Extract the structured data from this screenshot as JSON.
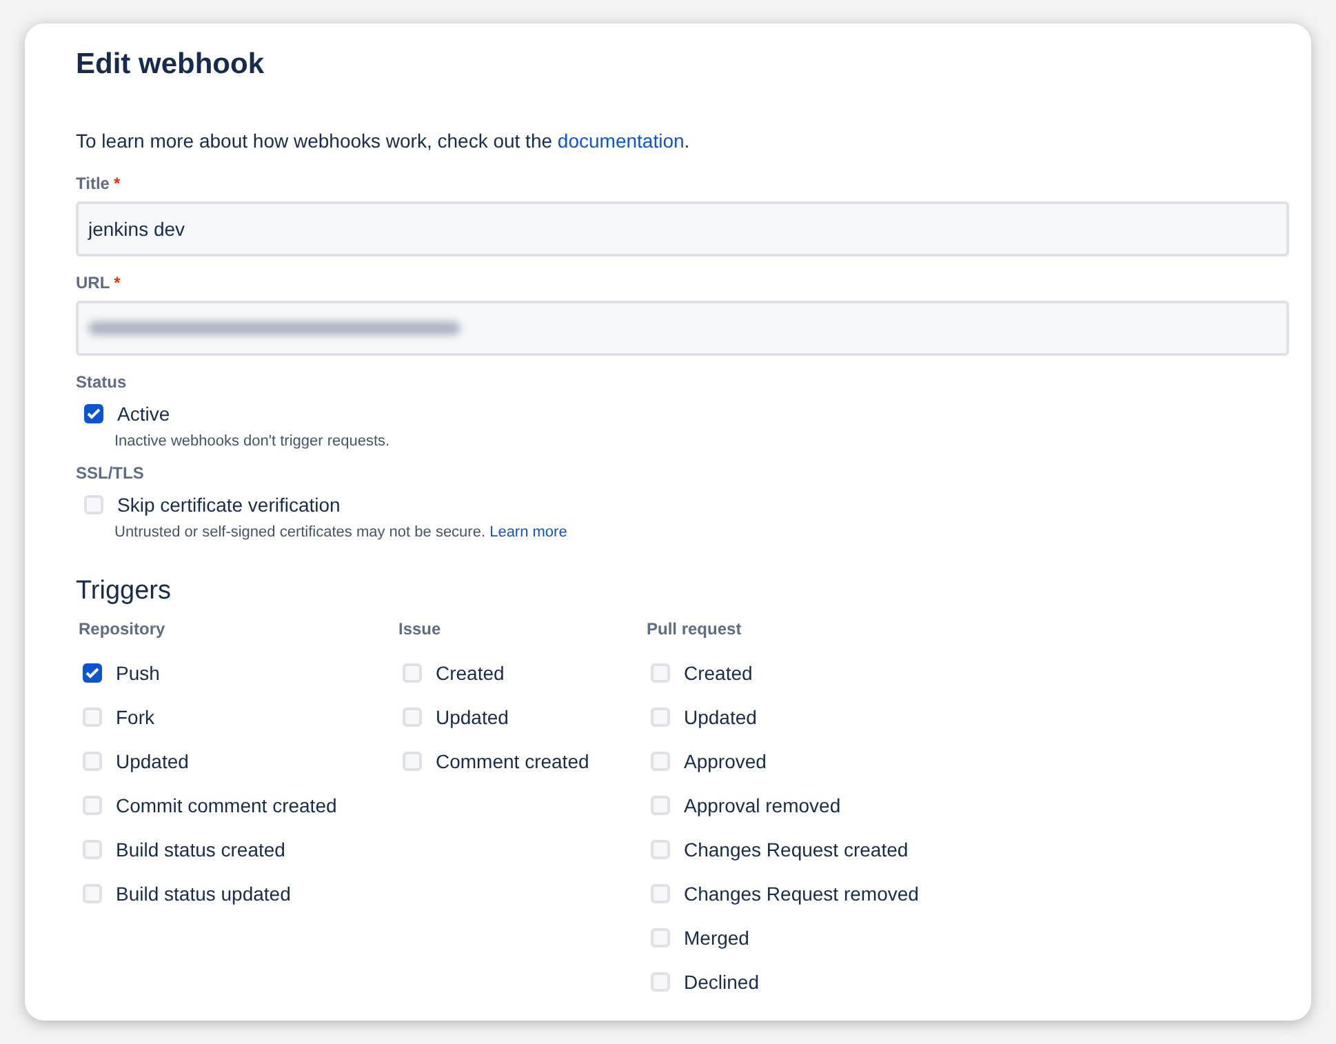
{
  "heading": "Edit webhook",
  "intro": {
    "before": "To learn more about how webhooks work, check out the ",
    "link": "documentation",
    "after": "."
  },
  "fields": [
    {
      "label": "Title",
      "required_mark": "*",
      "value": "jenkins dev",
      "obscured": false
    },
    {
      "label": "URL",
      "required_mark": "*",
      "obscured": true
    }
  ],
  "options": [
    {
      "group": "Status",
      "label": "Active",
      "checked": true,
      "help": "Inactive webhooks don't trigger requests."
    },
    {
      "group": "SSL/TLS",
      "label": "Skip certificate verification",
      "checked": false,
      "help": "Untrusted or self-signed certificates may not be secure.",
      "help_link": "Learn more"
    }
  ],
  "triggers": {
    "title": "Triggers",
    "columns": [
      {
        "title": "Repository",
        "items": [
          {
            "label": "Push",
            "checked": true
          },
          {
            "label": "Fork",
            "checked": false
          },
          {
            "label": "Updated",
            "checked": false
          },
          {
            "label": "Commit comment created",
            "checked": false
          },
          {
            "label": "Build status created",
            "checked": false
          },
          {
            "label": "Build status updated",
            "checked": false
          }
        ]
      },
      {
        "title": "Issue",
        "items": [
          {
            "label": "Created",
            "checked": false
          },
          {
            "label": "Updated",
            "checked": false
          },
          {
            "label": "Comment created",
            "checked": false
          }
        ]
      },
      {
        "title": "Pull request",
        "items": [
          {
            "label": "Created",
            "checked": false
          },
          {
            "label": "Updated",
            "checked": false
          },
          {
            "label": "Approved",
            "checked": false
          },
          {
            "label": "Approval removed",
            "checked": false
          },
          {
            "label": "Changes Request created",
            "checked": false
          },
          {
            "label": "Changes Request removed",
            "checked": false
          },
          {
            "label": "Merged",
            "checked": false
          },
          {
            "label": "Declined",
            "checked": false
          }
        ]
      }
    ]
  }
}
